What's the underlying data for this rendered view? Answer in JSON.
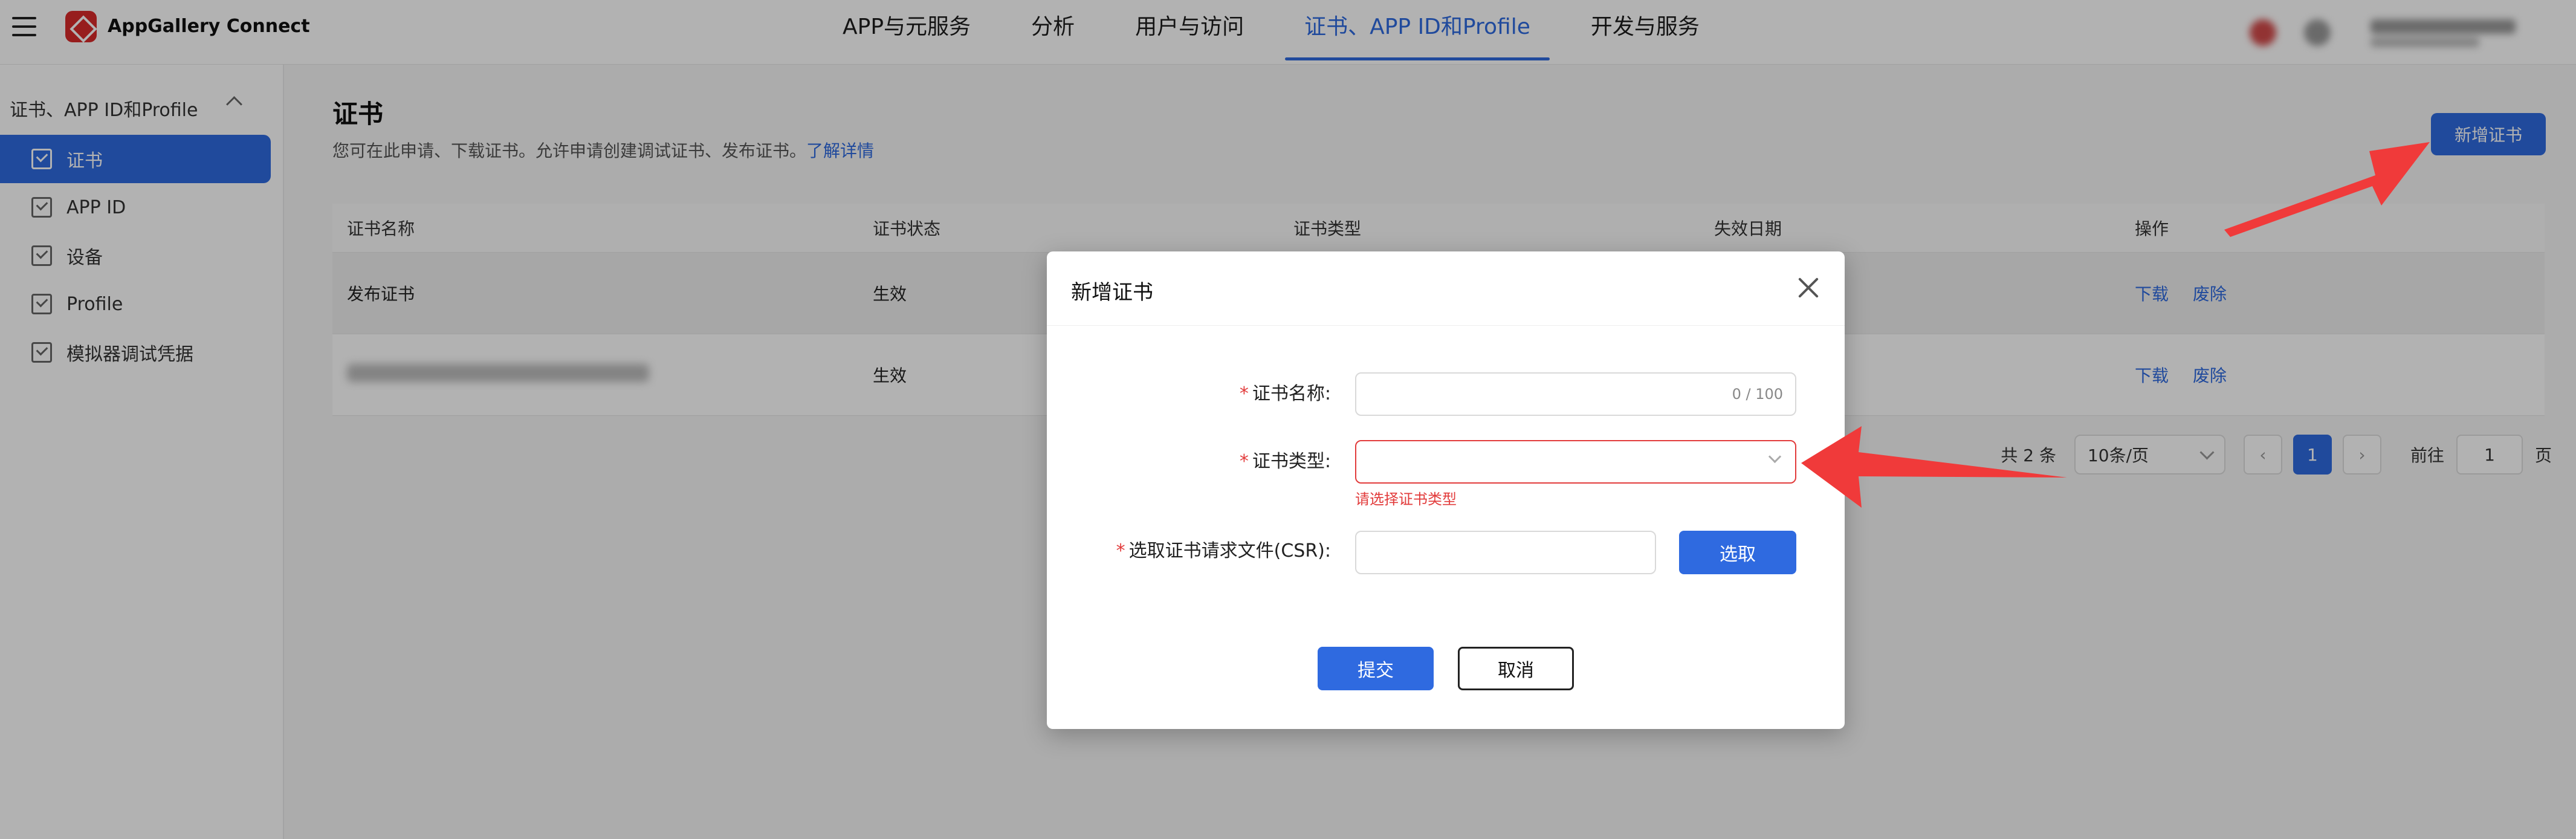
{
  "app": {
    "brand": "AppGallery Connect"
  },
  "top_nav": [
    {
      "label": "APP与元服务",
      "active": false
    },
    {
      "label": "分析",
      "active": false
    },
    {
      "label": "用户与访问",
      "active": false
    },
    {
      "label": "证书、APP ID和Profile",
      "active": true
    },
    {
      "label": "开发与服务",
      "active": false
    }
  ],
  "sidebar": {
    "group": "证书、APP ID和Profile",
    "items": [
      {
        "label": "证书",
        "active": true
      },
      {
        "label": "APP ID",
        "active": false
      },
      {
        "label": "设备",
        "active": false
      },
      {
        "label": "Profile",
        "active": false
      },
      {
        "label": "模拟器调试凭据",
        "active": false
      }
    ]
  },
  "page": {
    "title": "证书",
    "description": "您可在此申请、下载证书。允许申请创建调试证书、发布证书。",
    "learn_more": "了解详情",
    "new_button": "新增证书"
  },
  "table": {
    "headers": [
      "证书名称",
      "证书状态",
      "证书类型",
      "失效日期",
      "操作"
    ],
    "rows": [
      {
        "name": "发布证书",
        "status": "生效",
        "download": "下载",
        "revoke": "废除"
      },
      {
        "name": "",
        "status": "生效",
        "download": "下载",
        "revoke": "废除"
      }
    ]
  },
  "pagination": {
    "total": "共 2 条",
    "page_size": "10条/页",
    "current_page": "1",
    "goto_label": "前往",
    "goto_value": "1",
    "page_suffix": "页"
  },
  "modal": {
    "title": "新增证书",
    "name_label": "证书名称:",
    "name_counter": "0 / 100",
    "type_label": "证书类型:",
    "type_error": "请选择证书类型",
    "csr_label": "选取证书请求文件(CSR):",
    "select_button": "选取",
    "submit_button": "提交",
    "cancel_button": "取消"
  },
  "colors": {
    "accent": "#2f6ae0",
    "error": "#e23b3b",
    "annotation": "#f03a3a"
  }
}
